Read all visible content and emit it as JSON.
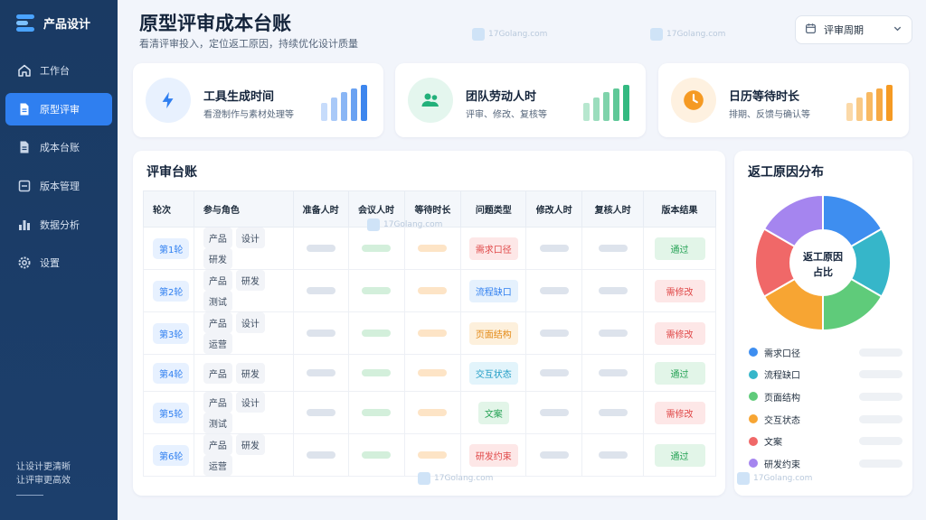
{
  "app": {
    "name": "产品设计"
  },
  "sidebar": {
    "items": [
      {
        "label": "工作台",
        "icon": "home-icon",
        "active": false
      },
      {
        "label": "原型评审",
        "icon": "document-icon",
        "active": true
      },
      {
        "label": "成本台账",
        "icon": "ledger-icon",
        "active": false
      },
      {
        "label": "版本管理",
        "icon": "version-icon",
        "active": false
      },
      {
        "label": "数据分析",
        "icon": "bar-chart-icon",
        "active": false
      },
      {
        "label": "设置",
        "icon": "gear-icon",
        "active": false
      }
    ],
    "slogan_line1": "让设计更清晰",
    "slogan_line2": "让评审更高效"
  },
  "header": {
    "title": "原型评审成本台账",
    "subtitle": "看清评审投入，定位返工原因，持续优化设计质量",
    "period_label": "评审周期"
  },
  "kpis": [
    {
      "title": "工具生成时间",
      "subtitle": "看澄制作与素材处理等",
      "icon": "lightning-icon",
      "accent": "#2f7ff0",
      "icon_bg": "#e8f1fe",
      "bar_colors": [
        "#c7dcfb",
        "#a9c9f8",
        "#8ab6f5",
        "#6aa2f2",
        "#3d86ee"
      ]
    },
    {
      "title": "团队劳动人时",
      "subtitle": "评审、修改、复核等",
      "icon": "team-icon",
      "accent": "#22b07a",
      "icon_bg": "#e4f6ee",
      "bar_colors": [
        "#b7e7cf",
        "#9bddbd",
        "#7fd3ab",
        "#5fc898",
        "#34b981"
      ]
    },
    {
      "title": "日历等待时长",
      "subtitle": "排期、反馈与确认等",
      "icon": "clock-icon",
      "accent": "#f59a23",
      "icon_bg": "#fef1e0",
      "bar_colors": [
        "#fbd9a8",
        "#f9c985",
        "#f8b962",
        "#f6a944",
        "#f59a23"
      ]
    }
  ],
  "ledger": {
    "title": "评审台账",
    "columns": [
      "轮次",
      "参与角色",
      "准备人时",
      "会议人时",
      "等待时长",
      "问题类型",
      "修改人时",
      "复核人时",
      "版本结果"
    ],
    "rows": [
      {
        "round": "第1轮",
        "roles": [
          "产品",
          "设计",
          "研发"
        ],
        "issue": "需求口径",
        "result": "通过"
      },
      {
        "round": "第2轮",
        "roles": [
          "产品",
          "研发",
          "测试"
        ],
        "issue": "流程缺口",
        "result": "需修改"
      },
      {
        "round": "第3轮",
        "roles": [
          "产品",
          "设计",
          "运营"
        ],
        "issue": "页面结构",
        "result": "需修改"
      },
      {
        "round": "第4轮",
        "roles": [
          "产品",
          "研发"
        ],
        "issue": "交互状态",
        "result": "通过"
      },
      {
        "round": "第5轮",
        "roles": [
          "产品",
          "设计",
          "测试"
        ],
        "issue": "文案",
        "result": "需修改"
      },
      {
        "round": "第6轮",
        "roles": [
          "产品",
          "研发",
          "运营"
        ],
        "issue": "研发约束",
        "result": "通过"
      }
    ]
  },
  "issue_colors": {
    "需求口径": {
      "bg": "#fde7e7",
      "fg": "#e04848"
    },
    "流程缺口": {
      "bg": "#e5f1fd",
      "fg": "#2f7ff0"
    },
    "页面结构": {
      "bg": "#fdf0dc",
      "fg": "#e38a17"
    },
    "交互状态": {
      "bg": "#e2f4fb",
      "fg": "#1f9cc4"
    },
    "文案": {
      "bg": "#e2f5e8",
      "fg": "#25a255"
    },
    "研发约束": {
      "bg": "#fde7e7",
      "fg": "#e04848"
    }
  },
  "result_colors": {
    "通过": {
      "bg": "#e2f5e8",
      "fg": "#25a255"
    },
    "需修改": {
      "bg": "#fde7e7",
      "fg": "#e04848"
    }
  },
  "donut": {
    "title": "返工原因分布",
    "center_line1": "返工原因",
    "center_line2": "占比",
    "segments": [
      {
        "name": "需求口径",
        "color": "#3e8ef0"
      },
      {
        "name": "流程缺口",
        "color": "#36b6c9"
      },
      {
        "name": "页面结构",
        "color": "#5fcb7a"
      },
      {
        "name": "交互状态",
        "color": "#f7a533"
      },
      {
        "name": "文案",
        "color": "#f06868"
      },
      {
        "name": "研发约束",
        "color": "#a585ef"
      }
    ]
  },
  "watermark": "17Golang.com"
}
